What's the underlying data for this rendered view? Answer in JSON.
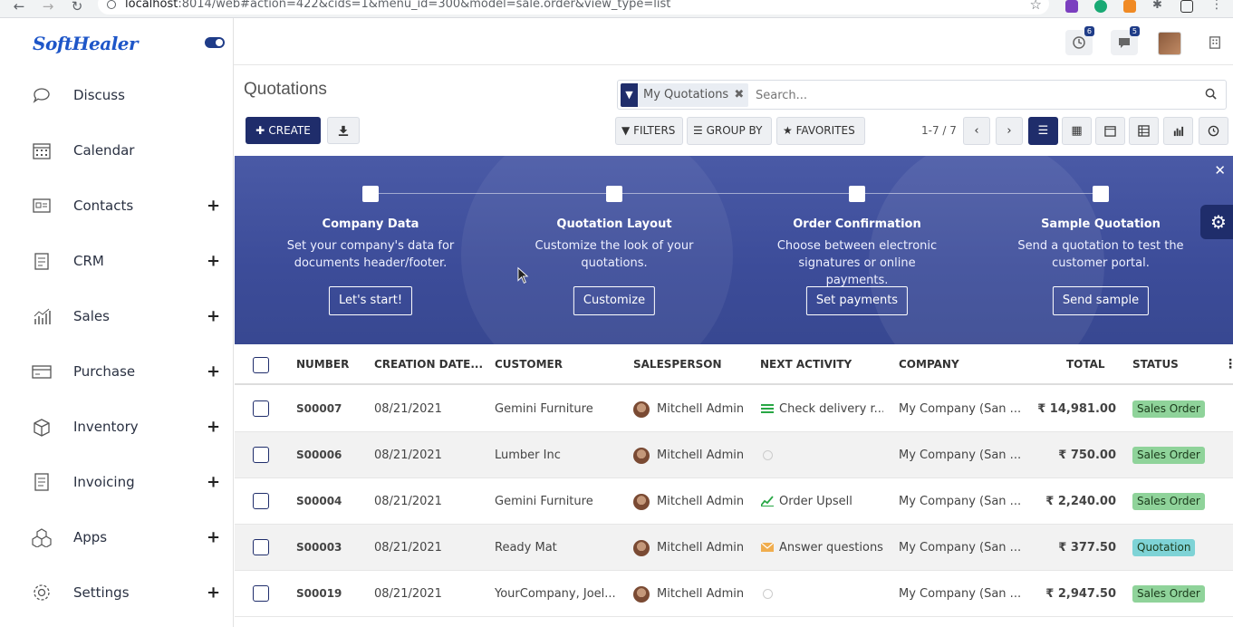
{
  "browser": {
    "url_host": "localhost",
    "url_rest": ":8014/web#action=422&cids=1&menu_id=300&model=sale.order&view_type=list"
  },
  "sidebar": {
    "logo": "SoftHealer",
    "items": [
      {
        "label": "Discuss",
        "icon": "chat-bubble-icon",
        "expandable": false
      },
      {
        "label": "Calendar",
        "icon": "calendar-icon",
        "expandable": false
      },
      {
        "label": "Contacts",
        "icon": "contact-card-icon",
        "expandable": true
      },
      {
        "label": "CRM",
        "icon": "crm-clipboard-icon",
        "expandable": true
      },
      {
        "label": "Sales",
        "icon": "sales-chart-icon",
        "expandable": true
      },
      {
        "label": "Purchase",
        "icon": "credit-card-icon",
        "expandable": true
      },
      {
        "label": "Inventory",
        "icon": "box-icon",
        "expandable": true
      },
      {
        "label": "Invoicing",
        "icon": "invoice-icon",
        "expandable": true
      },
      {
        "label": "Apps",
        "icon": "apps-cubes-icon",
        "expandable": true
      },
      {
        "label": "Settings",
        "icon": "gear-icon",
        "expandable": true
      }
    ]
  },
  "topbar": {
    "activity_count": "6",
    "messages_count": "5"
  },
  "control_panel": {
    "title": "Quotations",
    "create_label": "CREATE",
    "facet_label": "My Quotations",
    "search_placeholder": "Search...",
    "filters_label": "FILTERS",
    "groupby_label": "GROUP BY",
    "favorites_label": "FAVORITES",
    "pager": "1-7 / 7"
  },
  "banner": {
    "steps": [
      {
        "title": "Company Data",
        "desc": "Set your company's data for documents header/footer.",
        "button": "Let's start!"
      },
      {
        "title": "Quotation Layout",
        "desc": "Customize the look of your quotations.",
        "button": "Customize"
      },
      {
        "title": "Order Confirmation",
        "desc": "Choose between electronic signatures or online payments.",
        "button": "Set payments"
      },
      {
        "title": "Sample Quotation",
        "desc": "Send a quotation to test the customer portal.",
        "button": "Send sample"
      }
    ]
  },
  "table": {
    "headers": {
      "number": "NUMBER",
      "creation_date": "CREATION DATE...",
      "customer": "CUSTOMER",
      "salesperson": "SALESPERSON",
      "next_activity": "NEXT ACTIVITY",
      "company": "COMPANY",
      "total": "TOTAL",
      "status": "STATUS"
    },
    "rows": [
      {
        "number": "S00007",
        "date": "08/21/2021",
        "customer": "Gemini Furniture",
        "salesperson": "Mitchell Admin",
        "activity": "Check delivery r...",
        "activity_icon": "list",
        "company": "My Company (San ...",
        "total": "₹ 14,981.00",
        "status": "Sales Order",
        "status_color": "#8fd39a"
      },
      {
        "number": "S00006",
        "date": "08/21/2021",
        "customer": "Lumber Inc",
        "salesperson": "Mitchell Admin",
        "activity": "",
        "activity_icon": "clock",
        "company": "My Company (San ...",
        "total": "₹ 750.00",
        "status": "Sales Order",
        "status_color": "#8fd39a"
      },
      {
        "number": "S00004",
        "date": "08/21/2021",
        "customer": "Gemini Furniture",
        "salesperson": "Mitchell Admin",
        "activity": "Order Upsell",
        "activity_icon": "chart",
        "company": "My Company (San ...",
        "total": "₹ 2,240.00",
        "status": "Sales Order",
        "status_color": "#8fd39a"
      },
      {
        "number": "S00003",
        "date": "08/21/2021",
        "customer": "Ready Mat",
        "salesperson": "Mitchell Admin",
        "activity": "Answer questions",
        "activity_icon": "email",
        "company": "My Company (San ...",
        "total": "₹ 377.50",
        "status": "Quotation",
        "status_color": "#7ed3d6"
      },
      {
        "number": "S00019",
        "date": "08/21/2021",
        "customer": "YourCompany, Joel...",
        "salesperson": "Mitchell Admin",
        "activity": "",
        "activity_icon": "clock",
        "company": "My Company (San ...",
        "total": "₹ 2,947.50",
        "status": "Sales Order",
        "status_color": "#8fd39a"
      }
    ]
  }
}
